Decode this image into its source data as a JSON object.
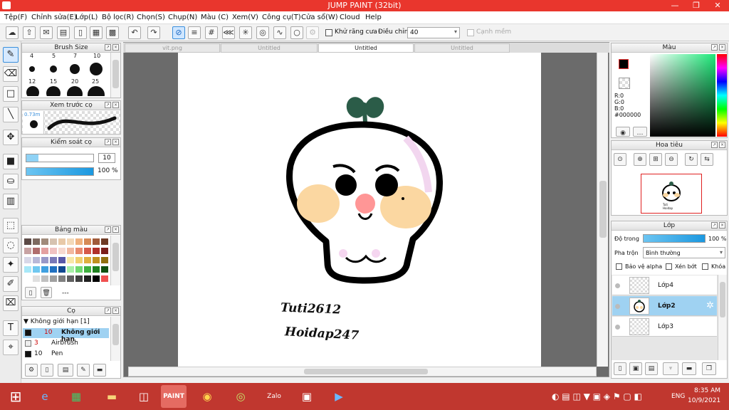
{
  "window": {
    "title": "JUMP PAINT (32bit)"
  },
  "menu": [
    "Tệp(F)",
    "Chỉnh sửa(E)",
    "Lớp(L)",
    "Bộ lọc(R)",
    "Chọn(S)",
    "Chụp(N)",
    "Màu (C)",
    "Xem(V)",
    "Công cụ(T)",
    "Cửa sổ(W)",
    "Cloud",
    "Help"
  ],
  "toolbar": {
    "antialias_label": "Khử răng cưa",
    "adjust_label": "Điều chỉnh",
    "adjust_value": "40",
    "edge_label": "Cạnh mềm"
  },
  "brush_size": {
    "title": "Brush Size",
    "sizes": [
      "4",
      "5",
      "7",
      "10",
      "12",
      "15",
      "20",
      "25"
    ]
  },
  "preview": {
    "title": "Xem trước cọ",
    "size_label": "0.73m"
  },
  "brush_control": {
    "title": "Kiểm soát cọ",
    "size_value": "10",
    "opacity_value": "100 %"
  },
  "palette": {
    "title": "Bảng màu",
    "footer": "---"
  },
  "brushes": {
    "title": "Cọ",
    "group": "Không giới hạn [1]",
    "items": [
      {
        "size": "10",
        "name": "Không giới hạn"
      },
      {
        "size": "3",
        "name": "Airbrush"
      },
      {
        "size": "10",
        "name": "Pen"
      }
    ]
  },
  "tabs": [
    "vit.png",
    "Untitled",
    "Untitled",
    "Untitled"
  ],
  "artwork": {
    "line1": "Tuti2612",
    "line2": "Hoidap247"
  },
  "color_panel": {
    "title": "Màu",
    "r": "R:0",
    "g": "G:0",
    "b": "B:0",
    "hex": "#000000"
  },
  "navigator": {
    "title": "Hoa tiêu",
    "thumb_text": "Tuti\nHoidap"
  },
  "layers": {
    "title": "Lớp",
    "opacity_label": "Độ trong",
    "opacity_value": "100 %",
    "blend_label": "Pha trộn",
    "blend_value": "Bình thường",
    "protect_alpha": "Bảo vệ alpha",
    "clip": "Xén bớt",
    "lock": "Khóa",
    "items": [
      "Lớp4",
      "Lớp2",
      "Lớp3"
    ]
  },
  "taskbar": {
    "lang": "ENG",
    "time": "8:35 AM",
    "date": "10/9/2021"
  }
}
